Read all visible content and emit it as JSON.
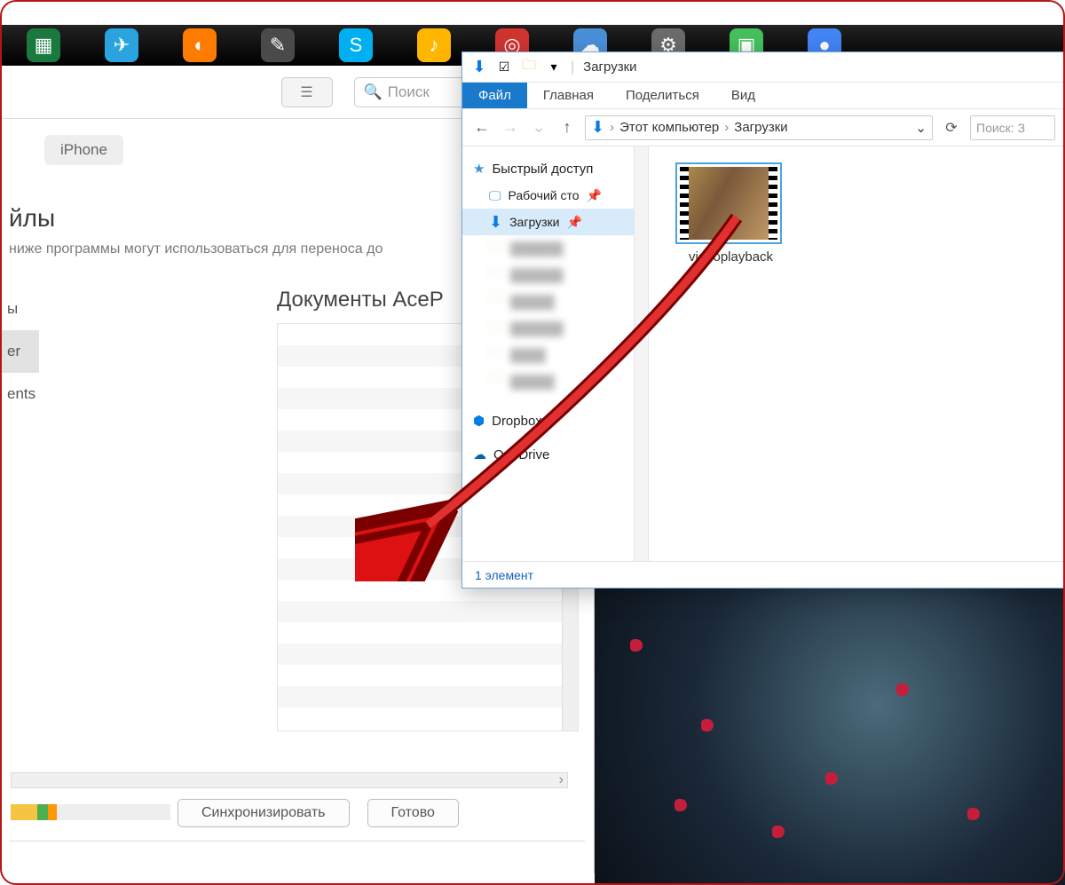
{
  "itunes": {
    "search_placeholder": "Поиск",
    "device_chip": "iPhone",
    "files_heading_partial": "йлы",
    "files_sub_partial": " ниже программы могут использоваться для переноса до",
    "left_items": [
      "ы",
      "er",
      "ents"
    ],
    "docs_heading_partial": "Документы AceP",
    "btn_sync": "Синхронизировать",
    "btn_done": "Готово"
  },
  "explorer": {
    "title": "Загрузки",
    "tabs": {
      "file": "Файл",
      "home": "Главная",
      "share": "Поделиться",
      "view": "Вид"
    },
    "breadcrumbs": [
      "Этот компьютер",
      "Загрузки"
    ],
    "refresh_dropdown": "⌄",
    "search_placeholder": "Поиск: З",
    "nav": {
      "quick": "Быстрый доступ",
      "desktop": "Рабочий сто",
      "downloads": "Загрузки",
      "dropbox": "Dropbox",
      "onedrive": "OneDrive"
    },
    "file_name": "videoplayback",
    "status": "1 элемент"
  }
}
